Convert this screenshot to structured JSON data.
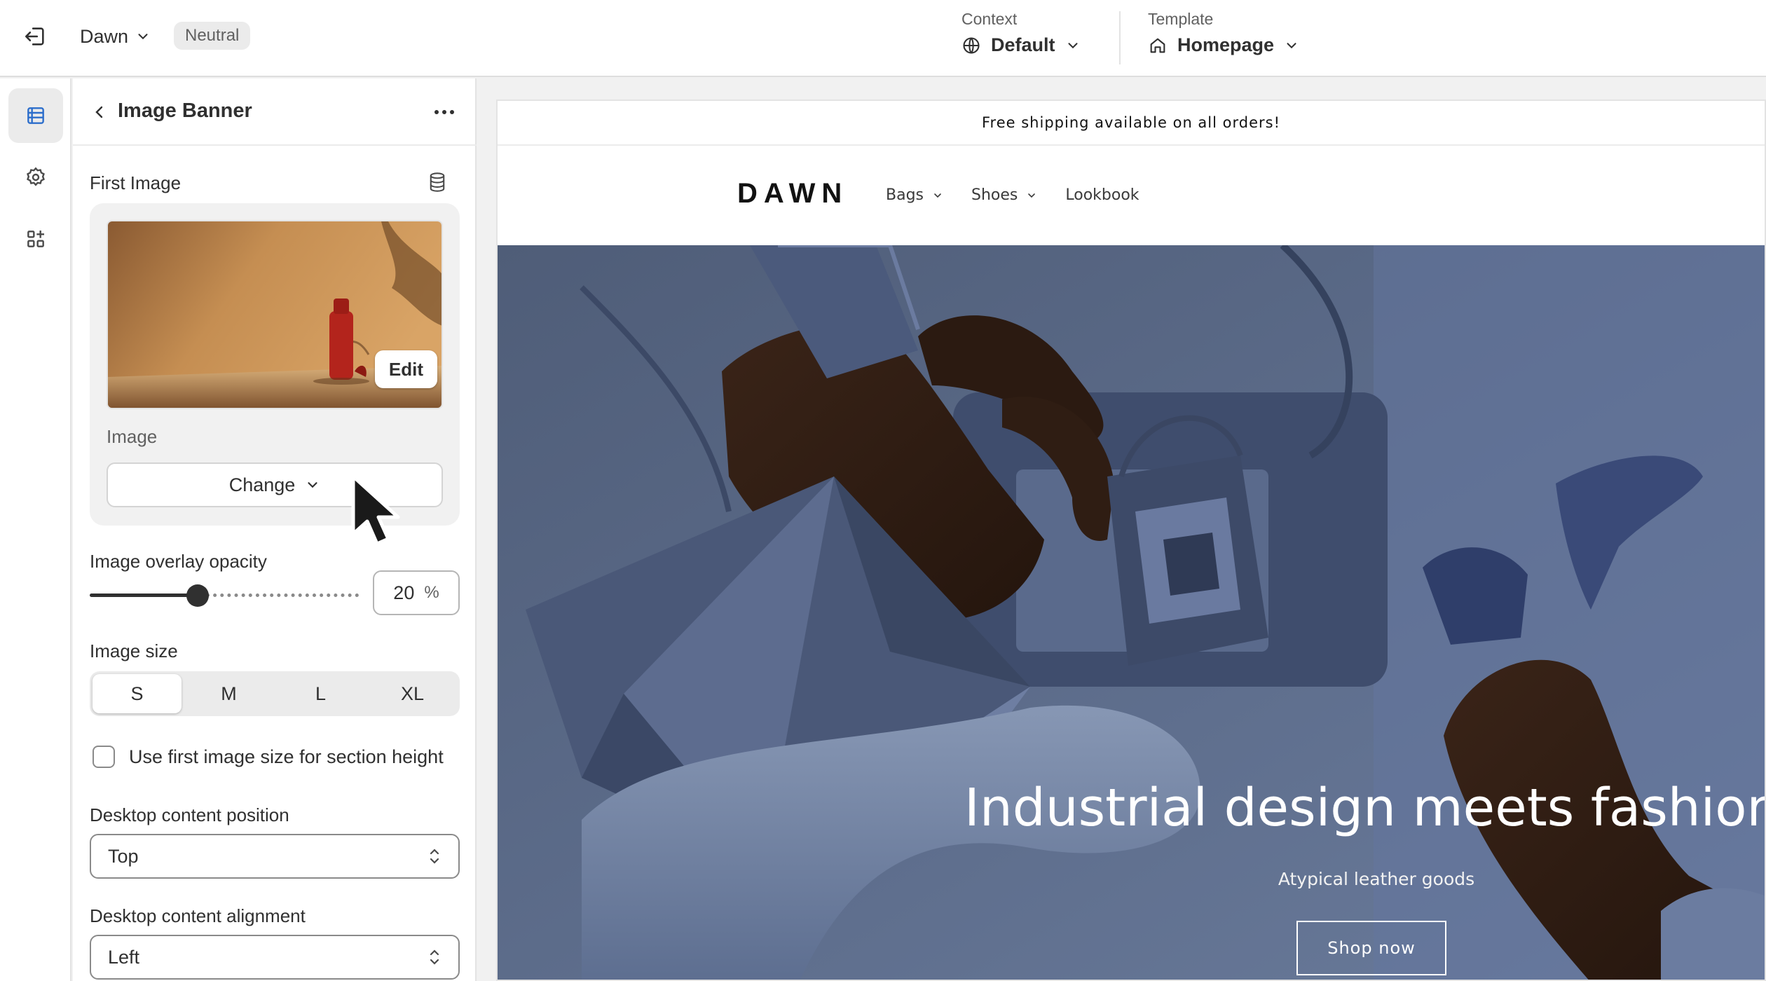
{
  "topbar": {
    "theme_name": "Dawn",
    "theme_badge": "Neutral",
    "context": {
      "label": "Context",
      "value": "Default"
    },
    "template": {
      "label": "Template",
      "value": "Homepage"
    }
  },
  "rail": {
    "items": [
      {
        "icon": "sections-icon",
        "active": true
      },
      {
        "icon": "gear-icon",
        "active": false
      },
      {
        "icon": "apps-icon",
        "active": false
      }
    ]
  },
  "panel": {
    "title": "Image Banner",
    "first_image": {
      "label": "First Image",
      "edit_label": "Edit",
      "image_label": "Image",
      "change_label": "Change"
    },
    "overlay": {
      "label": "Image overlay opacity",
      "value": "20",
      "unit": "%",
      "fraction": 0.2
    },
    "image_size": {
      "label": "Image size",
      "options": [
        "S",
        "M",
        "L",
        "XL"
      ],
      "selected": "S"
    },
    "use_first_size": {
      "label": "Use first image size for section height",
      "checked": false
    },
    "desktop_position": {
      "label": "Desktop content position",
      "value": "Top"
    },
    "desktop_alignment": {
      "label": "Desktop content alignment",
      "value": "Left"
    }
  },
  "preview": {
    "announcement": "Free shipping available on all orders!",
    "logo": "DAWN",
    "nav": [
      {
        "label": "Bags",
        "dropdown": true
      },
      {
        "label": "Shoes",
        "dropdown": true
      },
      {
        "label": "Lookbook",
        "dropdown": false
      }
    ],
    "hero": {
      "heading": "Industrial design meets fashion",
      "subheading": "Atypical leather goods",
      "button": "Shop now"
    }
  },
  "colors": {
    "ink": "#303030",
    "hero_bg": "#5e6d8a",
    "thumb_bg": "#c28a4e",
    "bottle": "#b3241c"
  }
}
